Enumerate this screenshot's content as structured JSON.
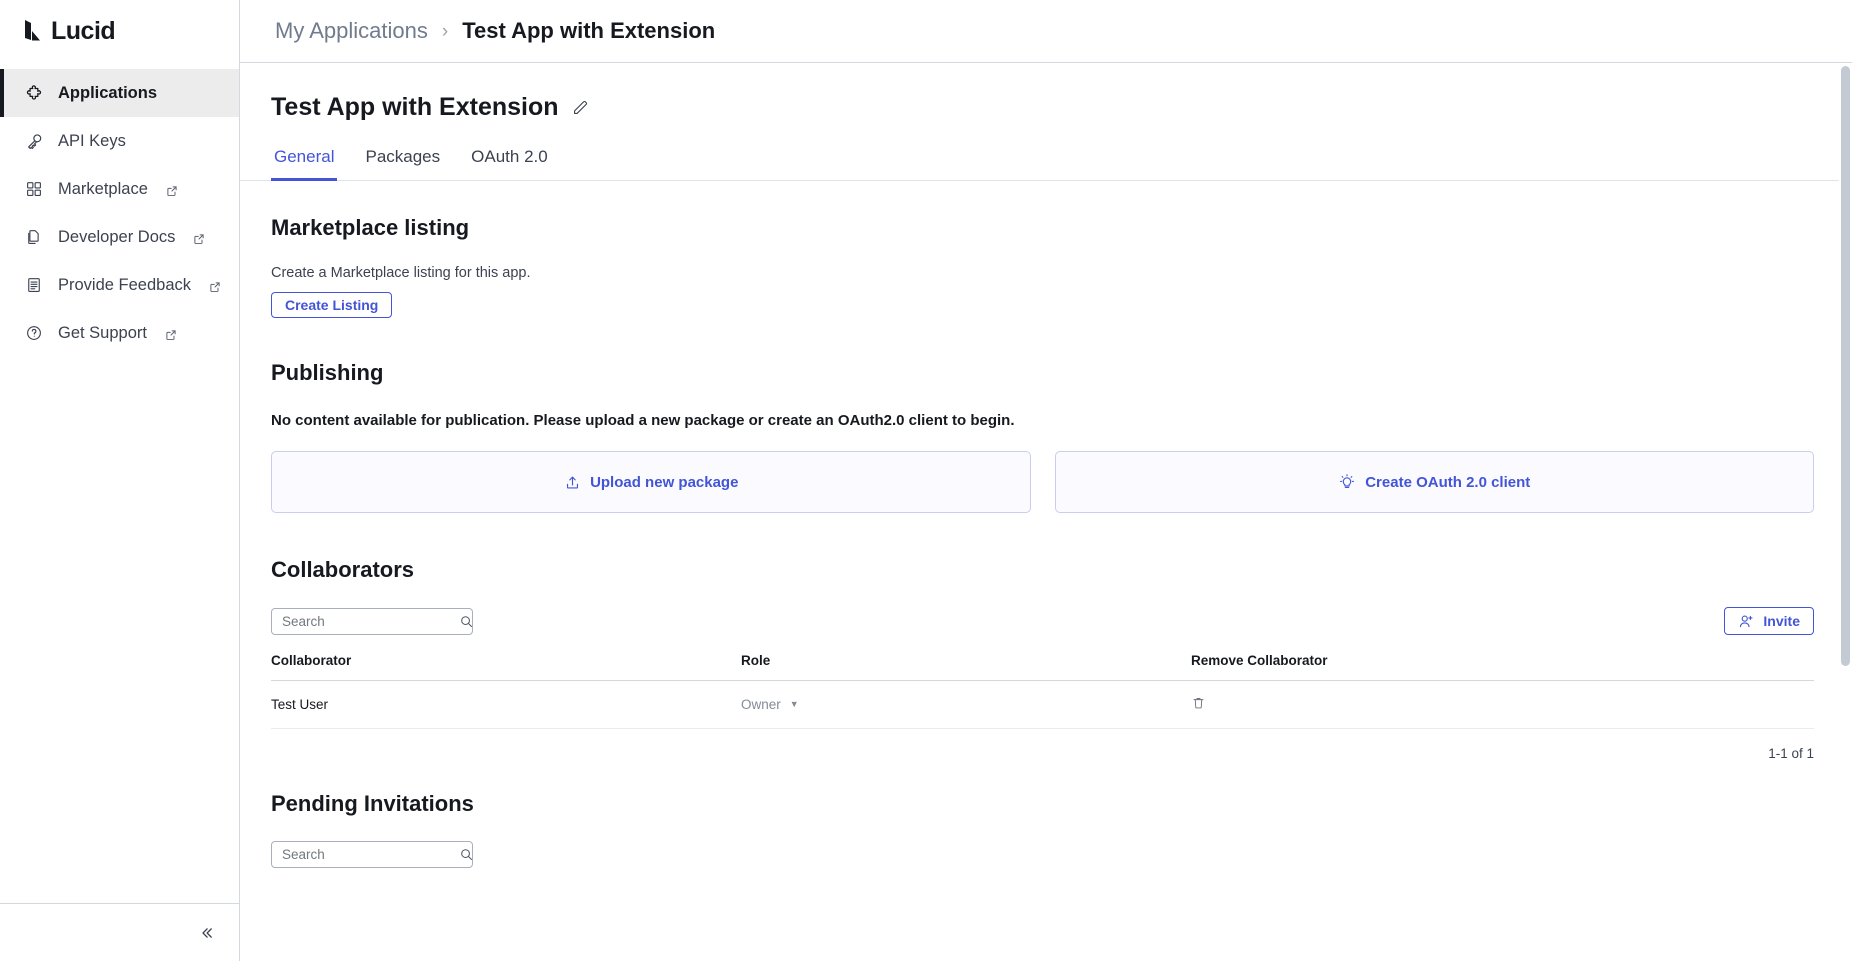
{
  "brand": {
    "name": "Lucid",
    "logo_icon": "lucid-logo-mark"
  },
  "sidebar": {
    "items": [
      {
        "label": "Applications",
        "icon": "puzzle-icon",
        "active": true,
        "external": false
      },
      {
        "label": "API Keys",
        "icon": "key-icon",
        "active": false,
        "external": false
      },
      {
        "label": "Marketplace",
        "icon": "grid-icon",
        "active": false,
        "external": true
      },
      {
        "label": "Developer Docs",
        "icon": "documents-icon",
        "active": false,
        "external": true
      },
      {
        "label": "Provide Feedback",
        "icon": "document-lines-icon",
        "active": false,
        "external": true
      },
      {
        "label": "Get Support",
        "icon": "question-circle-icon",
        "active": false,
        "external": true
      }
    ],
    "collapse_icon": "chevron-double-left-icon"
  },
  "breadcrumb": {
    "parent": "My Applications",
    "separator": "›",
    "current": "Test App with Extension"
  },
  "page": {
    "title": "Test App with Extension",
    "edit_icon": "pencil-icon"
  },
  "tabs": [
    {
      "label": "General",
      "active": true
    },
    {
      "label": "Packages",
      "active": false
    },
    {
      "label": "OAuth 2.0",
      "active": false
    }
  ],
  "marketplace": {
    "heading": "Marketplace listing",
    "description": "Create a Marketplace listing for this app.",
    "create_button": "Create Listing"
  },
  "publishing": {
    "heading": "Publishing",
    "notice": "No content available for publication. Please upload a new package or create an OAuth2.0 client to begin.",
    "cards": [
      {
        "label": "Upload new package",
        "icon": "upload-icon"
      },
      {
        "label": "Create OAuth 2.0 client",
        "icon": "lightbulb-icon"
      }
    ]
  },
  "collaborators": {
    "heading": "Collaborators",
    "search_placeholder": "Search",
    "search_value": "",
    "search_icon": "search-icon",
    "invite_button": "Invite",
    "invite_icon": "user-plus-icon",
    "columns": [
      "Collaborator",
      "Role",
      "Remove Collaborator"
    ],
    "rows": [
      {
        "name": "Test User",
        "role": "Owner",
        "remove_icon": "trash-icon"
      }
    ],
    "pagination": "1-1 of 1"
  },
  "pending_invitations": {
    "heading": "Pending Invitations",
    "search_placeholder": "Search",
    "search_value": "",
    "search_icon": "search-icon"
  },
  "colors": {
    "accent": "#4355d6",
    "card_bg": "#fafaff",
    "card_border": "#c9cdf0",
    "sidebar_active_bg": "#ececec",
    "text_dark": "#16191f",
    "text_muted": "#707b8c"
  }
}
